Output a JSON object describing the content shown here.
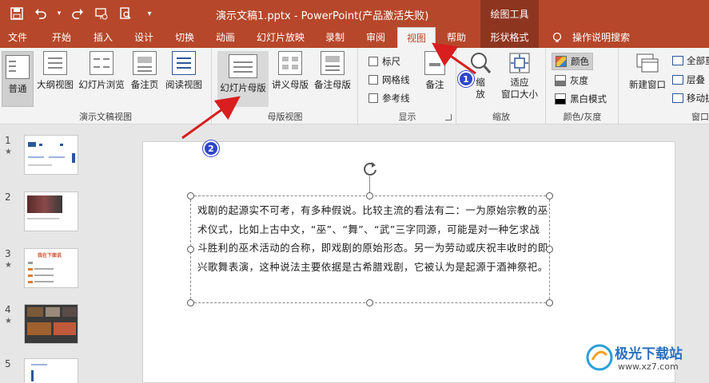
{
  "titlebar": {
    "document_title": "演示文稿1.pptx  -  PowerPoint(产品激活失败)",
    "contextual_tools": "绘图工具"
  },
  "tabs": [
    "文件",
    "开始",
    "插入",
    "设计",
    "切换",
    "动画",
    "幻灯片放映",
    "录制",
    "审阅",
    "视图",
    "帮助",
    "形状格式",
    "操作说明搜索"
  ],
  "ribbon": {
    "presentation_views": {
      "label": "演示文稿视图",
      "buttons": [
        "普通",
        "大纲视图",
        "幻灯片浏览",
        "备注页",
        "阅读视图"
      ]
    },
    "master_views": {
      "label": "母版视图",
      "buttons": [
        "幻灯片母版",
        "讲义母版",
        "备注母版"
      ]
    },
    "show": {
      "label": "显示",
      "checkboxes": [
        "标尺",
        "网格线",
        "参考线"
      ],
      "notes": "备注"
    },
    "zoom": {
      "label": "缩放",
      "zoom_btn": "缩\n放",
      "fit_btn": "适应\n窗口大小"
    },
    "color": {
      "label": "颜色/灰度",
      "items": [
        "颜色",
        "灰度",
        "黑白模式"
      ]
    },
    "window": {
      "label": "窗口",
      "new_window": "新建窗口",
      "items": [
        "全部重",
        "层叠",
        "移动拆"
      ]
    }
  },
  "thumbnails": [
    {
      "num": "1",
      "star": "★"
    },
    {
      "num": "2",
      "star": ""
    },
    {
      "num": "3",
      "star": "★"
    },
    {
      "num": "4",
      "star": "★"
    },
    {
      "num": "5",
      "star": ""
    }
  ],
  "thumb3_title": "我在下面说",
  "slide": {
    "text": "戏剧的起源实不可考，有多种假说。比较主流的看法有二：一为原始宗教的巫术仪式，比如上古中文，“巫”、“舞”、“武”三字同源，可能是对一种乞求战斗胜利的巫术活动的合称，即戏剧的原始形态。另一为劳动或庆祝丰收时的即兴歌舞表演，这种说法主要依据是古希腊戏剧，它被认为是起源于酒神祭祀。"
  },
  "badges": [
    "1",
    "2"
  ],
  "watermark": {
    "title": "极光下载站",
    "url": "www.xz7.com"
  },
  "colors": {
    "accent": "#b7472a",
    "contextual": "#8e3520",
    "annotation_red": "#d81e1e",
    "badge_blue": "#2f45c9"
  }
}
